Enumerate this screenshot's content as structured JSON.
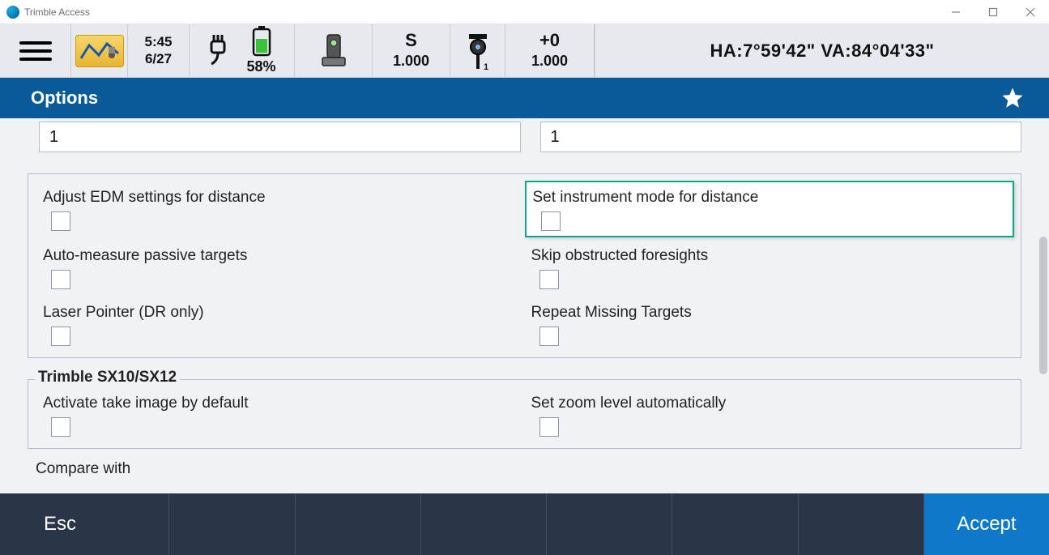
{
  "window": {
    "title": "Trimble Access"
  },
  "status": {
    "time": "5:45",
    "date": "6/27",
    "battery_pct": "58%",
    "s_label": "S",
    "s_value": "1.000",
    "target_offset": "+0",
    "target_value": "1.000",
    "angles": "HA:7°59'42\"  VA:84°04'33\""
  },
  "header": {
    "title": "Options"
  },
  "inputs": {
    "left": "1",
    "right": "1"
  },
  "group1": {
    "adjust_edm": "Adjust EDM settings for distance",
    "set_instr_mode": "Set instrument mode for distance",
    "auto_measure": "Auto-measure passive targets",
    "skip_obstructed": "Skip obstructed foresights",
    "laser_pointer": "Laser Pointer (DR only)",
    "repeat_missing": "Repeat Missing Targets"
  },
  "group2": {
    "legend": "Trimble SX10/SX12",
    "activate_take_image": "Activate take image by default",
    "set_zoom_auto": "Set zoom level automatically"
  },
  "compare_with": "Compare with",
  "softkeys": {
    "esc": "Esc",
    "accept": "Accept"
  }
}
